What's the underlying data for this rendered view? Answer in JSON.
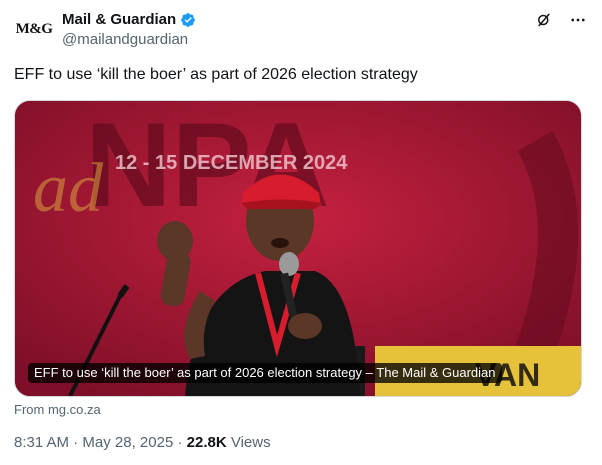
{
  "author": {
    "logo_text": "M&G",
    "display_name": "Mail & Guardian",
    "handle": "@mailandguardian",
    "verified_color": "#1d9bf0"
  },
  "actions": {
    "grok_icon": "grok-icon",
    "more_icon": "more-icon"
  },
  "tweet": {
    "text": "EFF to use ‘kill the boer’ as part of 2026 election strategy"
  },
  "card": {
    "caption": "EFF to use ‘kill the boer’ as part of 2026 election strategy – The Mail & Guardian",
    "banner_text": "12 - 15 DECEMBER 2024",
    "source": "From mg.co.za"
  },
  "meta": {
    "time": "8:31 AM",
    "date": "May 28, 2025",
    "views_count": "22.8K",
    "views_label": "Views"
  },
  "colors": {
    "background_red": "#a51a3a",
    "text_secondary": "#536471"
  }
}
